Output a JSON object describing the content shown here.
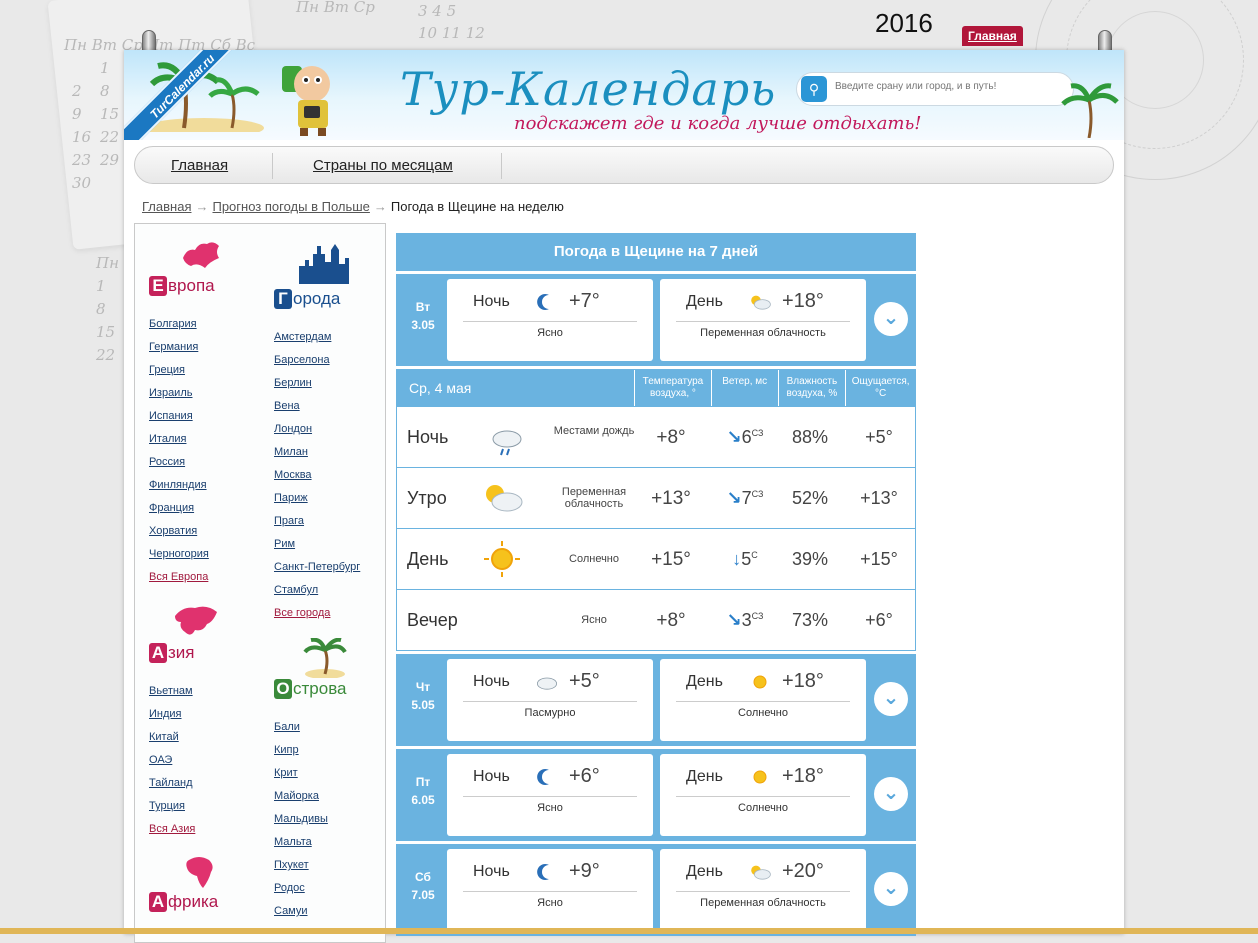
{
  "year": "2016",
  "top_home": "Главная",
  "background_digits": {
    "left_rows": [
      "Пн Вт Ср Чт Пт Сб Вс",
      "2",
      "9",
      "16",
      "23",
      "30"
    ],
    "left_col2": [
      "",
      "1",
      "8",
      "15",
      "22",
      "29"
    ],
    "top_rows": [
      "Пн Вт Ср",
      "3 4 5",
      "10 11 12"
    ],
    "lower_rows": [
      "Пн",
      "1",
      "8",
      "15",
      "22"
    ]
  },
  "header": {
    "ribbon": "TurCalendar.ru",
    "logo": "Тур-Календарь",
    "slogan": "подскажет где и когда лучше отдыхать!",
    "search_placeholder": "Введите срану или город, и в путь!"
  },
  "nav": {
    "items": [
      "Главная",
      "Страны по месяцам"
    ]
  },
  "breadcrumbs": {
    "items": [
      "Главная",
      "Прогноз погоды в Польше"
    ],
    "current": "Погода в Щецине на неделю"
  },
  "sidebar": {
    "europe": {
      "title_cap": "Е",
      "title_rest": "вропа",
      "items": [
        "Болгария",
        "Германия",
        "Греция",
        "Израиль",
        "Испания",
        "Италия",
        "Россия",
        "Финляндия",
        "Франция",
        "Хорватия",
        "Черногория"
      ],
      "all": "Вся Европа"
    },
    "cities": {
      "title_cap": "Г",
      "title_rest": "орода",
      "items": [
        "Амстердам",
        "Барселона",
        "Берлин",
        "Вена",
        "Лондон",
        "Милан",
        "Москва",
        "Париж",
        "Прага",
        "Рим",
        "Санкт-Петербург",
        "Стамбул"
      ],
      "all": "Все города"
    },
    "asia": {
      "title_cap": "А",
      "title_rest": "зия",
      "items": [
        "Вьетнам",
        "Индия",
        "Китай",
        "ОАЭ",
        "Тайланд",
        "Турция"
      ],
      "all": "Вся Азия"
    },
    "islands": {
      "title_cap": "О",
      "title_rest": "строва",
      "items": [
        "Бали",
        "Кипр",
        "Крит",
        "Майорка",
        "Мальдивы",
        "Мальта",
        "Пхукет",
        "Родос",
        "Самуи"
      ]
    },
    "africa": {
      "title_cap": "А",
      "title_rest": "фрика"
    }
  },
  "weather": {
    "title": "Погода в Щецине на 7 дней",
    "days": [
      {
        "dow": "Вт",
        "date": "3.05",
        "night": {
          "label": "Ночь",
          "icon": "moon-icon",
          "temp": "+7°",
          "desc": "Ясно"
        },
        "day": {
          "label": "День",
          "icon": "sun-cloud-icon",
          "temp": "+18°",
          "desc": "Переменная облачность"
        }
      }
    ],
    "detail": {
      "day": "Ср, 4 мая",
      "columns": [
        "Температура воздуха, °",
        "Ветер, мс",
        "Влажность воздуха, %",
        "Ощущается, °C"
      ],
      "rows": [
        {
          "period": "Ночь",
          "icon": "moon-rain-icon",
          "cond": "Местами дождь",
          "temp": "+8°",
          "wind_dir": "↘",
          "wind": "6",
          "wind_sub": "СЗ",
          "hum": "88%",
          "feels": "+5°"
        },
        {
          "period": "Утро",
          "icon": "sun-cloud-icon",
          "cond": "Переменная облачность",
          "temp": "+13°",
          "wind_dir": "↘",
          "wind": "7",
          "wind_sub": "СЗ",
          "hum": "52%",
          "feels": "+13°"
        },
        {
          "period": "День",
          "icon": "sun-icon",
          "cond": "Солнечно",
          "temp": "+15°",
          "wind_dir": "↓",
          "wind": "5",
          "wind_sub": "С",
          "hum": "39%",
          "feels": "+15°"
        },
        {
          "period": "Вечер",
          "icon": "moon-icon",
          "cond": "Ясно",
          "temp": "+8°",
          "wind_dir": "↘",
          "wind": "3",
          "wind_sub": "СЗ",
          "hum": "73%",
          "feels": "+6°"
        }
      ]
    },
    "days_after": [
      {
        "dow": "Чт",
        "date": "5.05",
        "night": {
          "label": "Ночь",
          "icon": "cloud-icon",
          "temp": "+5°",
          "desc": "Пасмурно"
        },
        "day": {
          "label": "День",
          "icon": "sun-icon",
          "temp": "+18°",
          "desc": "Солнечно"
        }
      },
      {
        "dow": "Пт",
        "date": "6.05",
        "night": {
          "label": "Ночь",
          "icon": "moon-icon",
          "temp": "+6°",
          "desc": "Ясно"
        },
        "day": {
          "label": "День",
          "icon": "sun-icon",
          "temp": "+18°",
          "desc": "Солнечно"
        }
      },
      {
        "dow": "Сб",
        "date": "7.05",
        "night": {
          "label": "Ночь",
          "icon": "moon-icon",
          "temp": "+9°",
          "desc": "Ясно"
        },
        "day": {
          "label": "День",
          "icon": "sun-cloud-icon",
          "temp": "+20°",
          "desc": "Переменная облачность"
        }
      }
    ]
  },
  "colors": {
    "accent_blue": "#6ab3e0",
    "brand_pink": "#c4225a",
    "link": "#1a3f6e"
  }
}
